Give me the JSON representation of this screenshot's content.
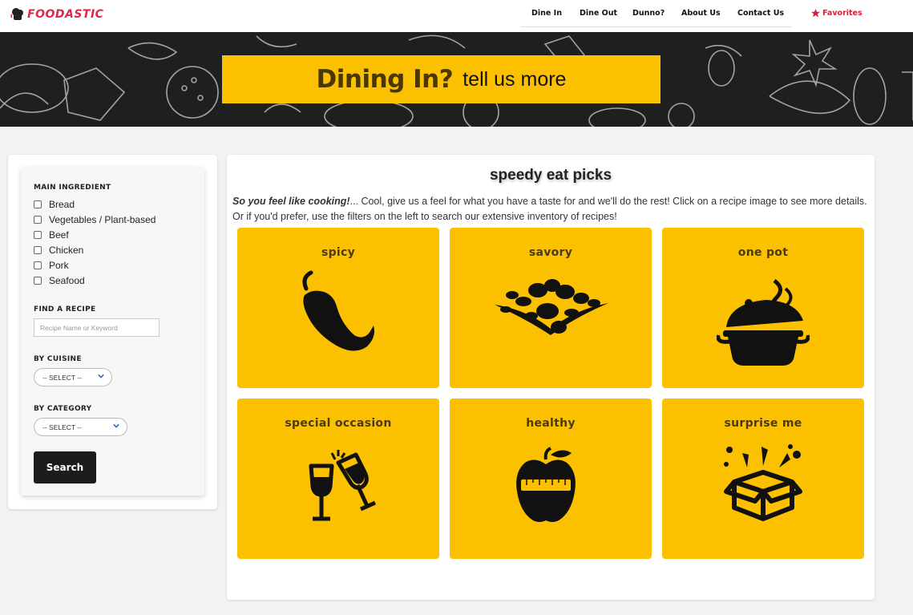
{
  "brand": {
    "name": "FOODASTIC"
  },
  "nav": {
    "links": [
      "Dine In",
      "Dine Out",
      "Dunno?",
      "About Us",
      "Contact Us"
    ],
    "favorites": "Favorites",
    "accent": "#d81f3a"
  },
  "hero": {
    "title": "Dining In?",
    "subtitle": "tell us more",
    "box_color": "#fbc101"
  },
  "sidebar": {
    "main_ingredient_title": "MAIN INGREDIENT",
    "ingredients": [
      "Bread",
      "Vegetables / Plant-based",
      "Beef",
      "Chicken",
      "Pork",
      "Seafood"
    ],
    "find_title": "FIND A RECIPE",
    "search_placeholder": "Recipe Name or Keyword",
    "cuisine_title": "BY CUISINE",
    "cuisine_select": "-- SELECT --",
    "category_title": "BY CATEGORY",
    "category_select": "-- SELECT --",
    "search_button": "Search"
  },
  "main": {
    "title": "speedy eat picks",
    "intro_bold": "So you feel like cooking!",
    "intro_text": "... Cool, give us a feel for what you have a taste for and we'll do the rest! Click on a recipe image to see more details. Or if you'd prefer, use the filters on the left to search our extensive inventory of recipes!",
    "tiles": [
      {
        "label": "spicy",
        "icon": "chili-pepper-icon"
      },
      {
        "label": "savory",
        "icon": "herbs-icon"
      },
      {
        "label": "one pot",
        "icon": "cooking-pot-icon"
      },
      {
        "label": "special occasion",
        "icon": "champagne-glasses-icon"
      },
      {
        "label": "healthy",
        "icon": "apple-measure-icon"
      },
      {
        "label": "surprise me",
        "icon": "surprise-box-icon"
      }
    ]
  }
}
